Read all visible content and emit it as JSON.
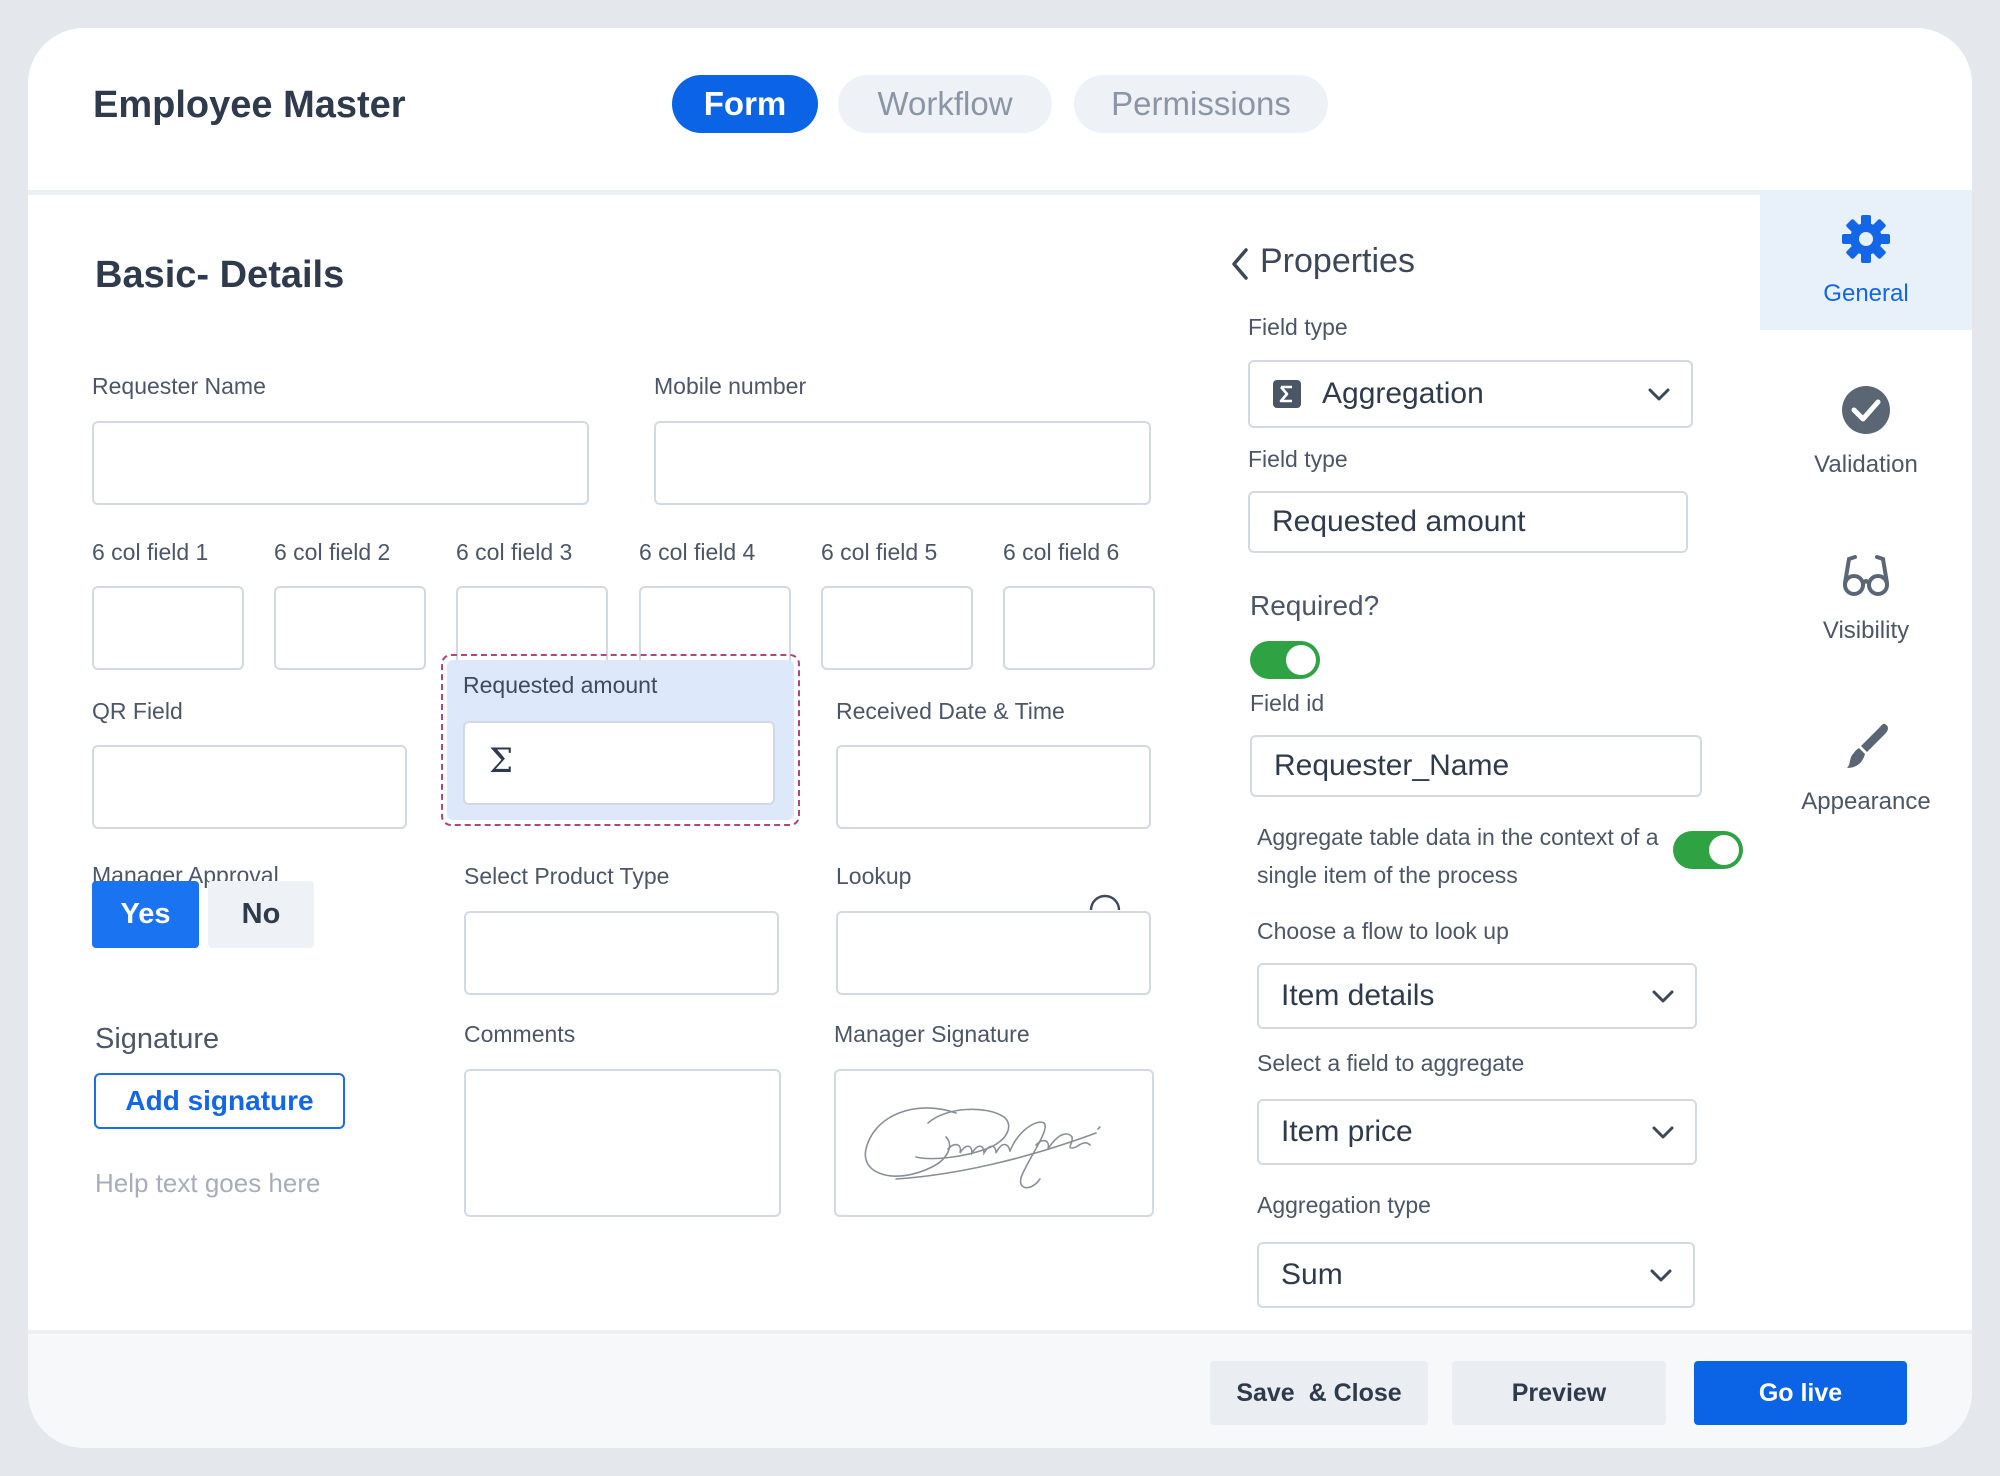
{
  "app": {
    "title": "Employee Master"
  },
  "tabs": [
    {
      "label": "Form",
      "active": true
    },
    {
      "label": "Workflow",
      "active": false
    },
    {
      "label": "Permissions",
      "active": false
    }
  ],
  "form": {
    "section_title": "Basic- Details",
    "fields": {
      "requester_name": "Requester Name",
      "mobile_number": "Mobile number",
      "six_col": [
        "6 col field 1",
        "6 col field 2",
        "6 col field 3",
        "6 col field 4",
        "6 col field 5",
        "6 col field 6"
      ],
      "qr_field": "QR Field",
      "requested_amount": "Requested amount",
      "received_date_time": "Received Date & Time",
      "manager_approval": "Manager Approval",
      "select_product_type": "Select Product Type",
      "lookup": "Lookup",
      "comments": "Comments",
      "manager_signature": "Manager Signature"
    },
    "approval": {
      "yes": "Yes",
      "no": "No",
      "selected": "Yes"
    },
    "signature": {
      "title": "Signature",
      "button": "Add signature",
      "help_text": "Help text goes here"
    }
  },
  "properties": {
    "title": "Properties",
    "field_type_label": "Field type",
    "field_type_value": "Aggregation",
    "field_type_label_2": "Field type",
    "field_type_value_2": "Requested amount",
    "required_label": "Required?",
    "required": true,
    "field_id_label": "Field id",
    "field_id_value": "Requester_Name",
    "aggregate_context_text": "Aggregate table data in the context of a single item of the process",
    "aggregate_context": true,
    "flow_label": "Choose a flow to look up",
    "flow_value": "Item details",
    "aggregate_field_label": "Select a field to aggregate",
    "aggregate_field_value": "Item price",
    "aggregation_type_label": "Aggregation type",
    "aggregation_type_value": "Sum"
  },
  "rail": [
    {
      "label": "General",
      "icon": "gear-icon",
      "active": true
    },
    {
      "label": "Validation",
      "icon": "check-circle-icon",
      "active": false
    },
    {
      "label": "Visibility",
      "icon": "glasses-icon",
      "active": false
    },
    {
      "label": "Appearance",
      "icon": "paintbrush-icon",
      "active": false
    }
  ],
  "footer": {
    "save_close": "Save  & Close",
    "preview": "Preview",
    "go_live": "Go live"
  },
  "colors": {
    "primary": "#0b63e6",
    "toggle_on": "#2fa244",
    "selected_bg": "#dde9fb",
    "selected_border": "#b0467c"
  }
}
